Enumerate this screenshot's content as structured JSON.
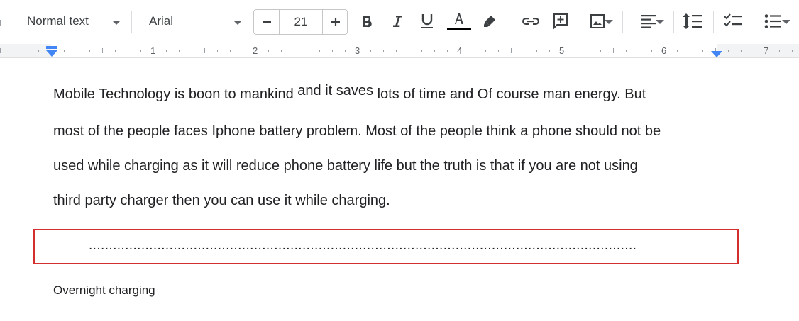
{
  "toolbar": {
    "style": "Normal text",
    "font": "Arial",
    "font_size": "21"
  },
  "ruler": {
    "numbers": [
      "1",
      "2",
      "3",
      "4",
      "5",
      "6",
      "7"
    ]
  },
  "document": {
    "line1_a": "Mobile Technology is boon to mankind ",
    "line1_sup": "and it saves",
    "line1_b": " lots of time and Of course man energy. But",
    "line2": "most of the people faces Iphone battery problem. Most of the people think a phone should not be",
    "line3": "used while charging as it will reduce phone battery life but the truth is that if you are not using",
    "line4": "third party charger then you can use it while charging.",
    "dotted_line": "........................................................................................................................................",
    "heading": "Overnight charging"
  },
  "colors": {
    "highlight_border": "#d32f2f",
    "ruler_marker": "#4285f4"
  }
}
